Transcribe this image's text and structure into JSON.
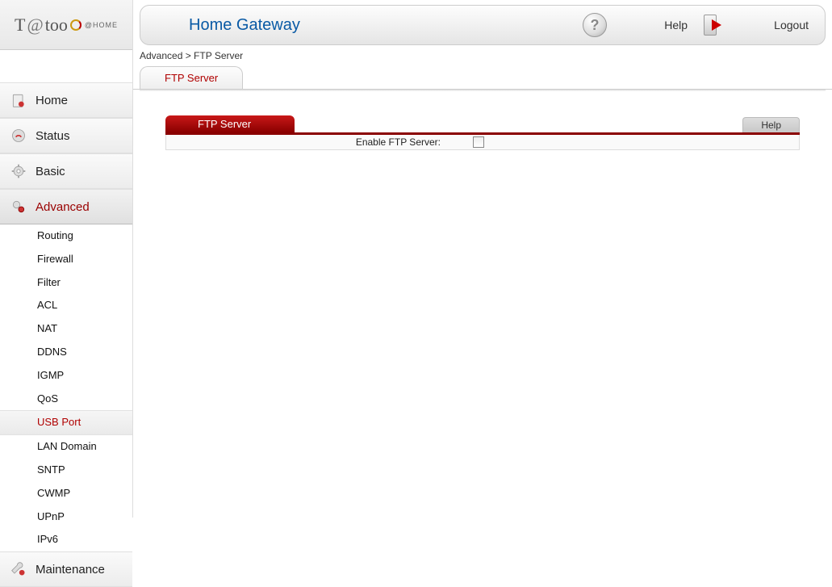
{
  "logo": {
    "brand_prefix": "T",
    "brand_at": "@",
    "brand_mid": "too",
    "home_label": "@HOME"
  },
  "header": {
    "title": "Home Gateway",
    "help_label": "Help",
    "logout_label": "Logout"
  },
  "breadcrumb": "Advanced > FTP Server",
  "tab": {
    "label": "FTP Server"
  },
  "nav": {
    "items": [
      {
        "label": "Home"
      },
      {
        "label": "Status"
      },
      {
        "label": "Basic"
      },
      {
        "label": "Advanced"
      },
      {
        "label": "Maintenance"
      }
    ],
    "advanced_sub": [
      "Routing",
      "Firewall",
      "Filter",
      "ACL",
      "NAT",
      "DDNS",
      "IGMP",
      "QoS",
      "USB Port",
      "LAN Domain",
      "SNTP",
      "CWMP",
      "UPnP",
      "IPv6"
    ],
    "active_sub": "USB Port"
  },
  "panel": {
    "title": "FTP Server",
    "help": "Help",
    "row_label": "Enable FTP Server:",
    "checked": false
  }
}
